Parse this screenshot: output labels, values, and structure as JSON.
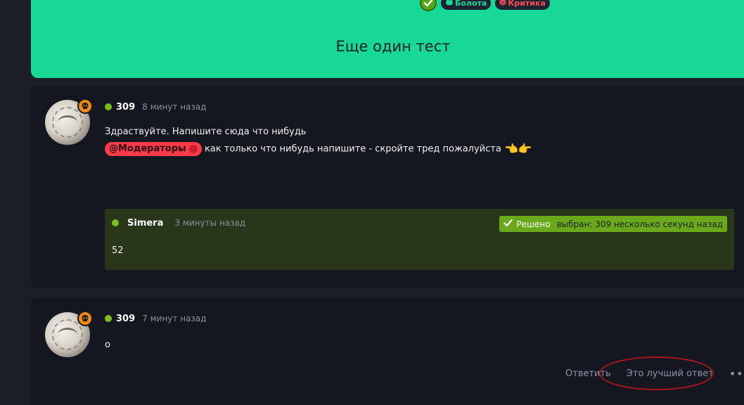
{
  "topic": {
    "title": "Еще один тест",
    "tags": [
      {
        "label": "Болота",
        "icon": "frog-icon"
      },
      {
        "label": "Критика",
        "icon": "angry-face-icon"
      }
    ],
    "solved_icon": "check-icon",
    "accent": "#18d898"
  },
  "posts": [
    {
      "username": "309",
      "time": "8 минут назад",
      "line1": "Здраствуйте. Напишите сюда что нибудь",
      "mention": "@Модераторы",
      "line2": "как только что нибудь напишите - скройте тред пожалуйста",
      "emoji": "👈👉",
      "quote": {
        "username": "Simera",
        "time": "3 минуты назад",
        "body": "52",
        "solved_label": "Решено",
        "chosen_label": "выбран: 309 несколько секунд назад"
      }
    },
    {
      "username": "309",
      "time": "7 минут назад",
      "body": "о",
      "actions": {
        "reply": "Ответить",
        "best_answer": "Это лучший ответ",
        "more": "•••"
      }
    }
  ],
  "colors": {
    "background": "#1c1e26",
    "card": "#141620",
    "online": "#7bbf1a",
    "solved": "#6aa81c",
    "mention": "#ff3b4b"
  }
}
